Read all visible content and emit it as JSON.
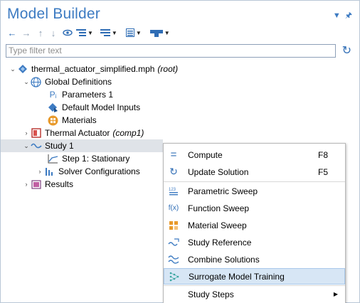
{
  "panel": {
    "title": "Model Builder",
    "pin_icons": [
      "chevron-down-icon",
      "pin-icon"
    ]
  },
  "toolbar": {
    "buttons": [
      "back-arrow-icon",
      "forward-arrow-icon",
      "up-arrow-icon",
      "down-arrow-icon",
      "show-icon",
      "collapse-icon",
      "expand-icon",
      "dynamic-help-icon",
      "node-actions-icon"
    ]
  },
  "filter": {
    "placeholder": "Type filter text"
  },
  "tree": {
    "root": {
      "name": "thermal_actuator_simplified.mph",
      "suffix": "(root)"
    },
    "global_definitions": "Global Definitions",
    "parameters": "Parameters 1",
    "default_model_inputs": "Default Model Inputs",
    "materials": "Materials",
    "component": {
      "name": "Thermal Actuator",
      "suffix": "(comp1)"
    },
    "study": "Study 1",
    "step1": "Step 1: Stationary",
    "solver_configurations": "Solver Configurations",
    "results": "Results"
  },
  "context_menu": {
    "items": [
      {
        "label": "Compute",
        "shortcut": "F8",
        "icon": "equals-icon"
      },
      {
        "label": "Update Solution",
        "shortcut": "F5",
        "icon": "refresh-icon"
      },
      {
        "label": "Parametric Sweep",
        "shortcut": "",
        "icon": "parametric-sweep-icon"
      },
      {
        "label": "Function Sweep",
        "shortcut": "",
        "icon": "function-sweep-icon"
      },
      {
        "label": "Material Sweep",
        "shortcut": "",
        "icon": "material-sweep-icon"
      },
      {
        "label": "Study Reference",
        "shortcut": "",
        "icon": "study-reference-icon"
      },
      {
        "label": "Combine Solutions",
        "shortcut": "",
        "icon": "combine-solutions-icon"
      },
      {
        "label": "Surrogate Model Training",
        "shortcut": "",
        "icon": "surrogate-model-icon"
      },
      {
        "label": "Study Steps",
        "shortcut": "",
        "icon": ""
      }
    ]
  },
  "colors": {
    "accent": "#3d7bc2",
    "highlight": "#d7e6f5",
    "selected_row": "#dfe3e8"
  }
}
